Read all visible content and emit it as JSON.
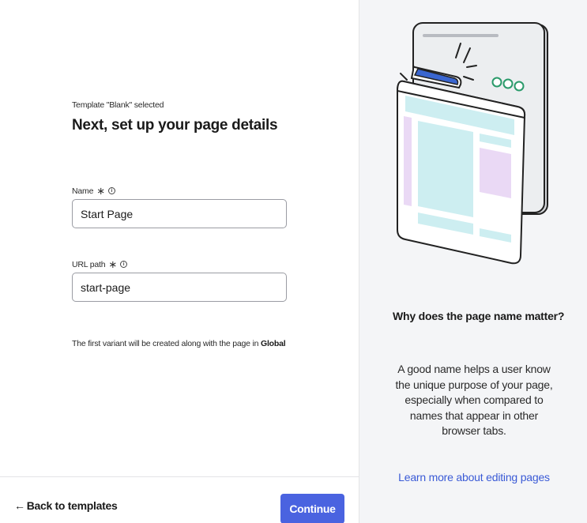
{
  "form": {
    "subtitle": "Template \"Blank\" selected",
    "title": "Next, set up your page details",
    "name_label": "Name",
    "name_value": "Start Page",
    "url_label": "URL path",
    "url_value": "start-page",
    "required_mark": "∗",
    "note_prefix": "The first variant will be created along with the page in ",
    "note_bold": "Global"
  },
  "footer": {
    "back_arrow": "←",
    "back_label": "Back to templates",
    "continue_label": "Continue"
  },
  "aside": {
    "why_title": "Why does the page name matter?",
    "why_body": "A good name helps a user know the unique purpose of your page, especially when compared to names that appear in other browser tabs.",
    "learn_link": "Learn more about editing pages"
  },
  "colors": {
    "accent": "#4a63e0",
    "link": "#3a5ad6",
    "panel_bg": "#f4f5f7"
  }
}
